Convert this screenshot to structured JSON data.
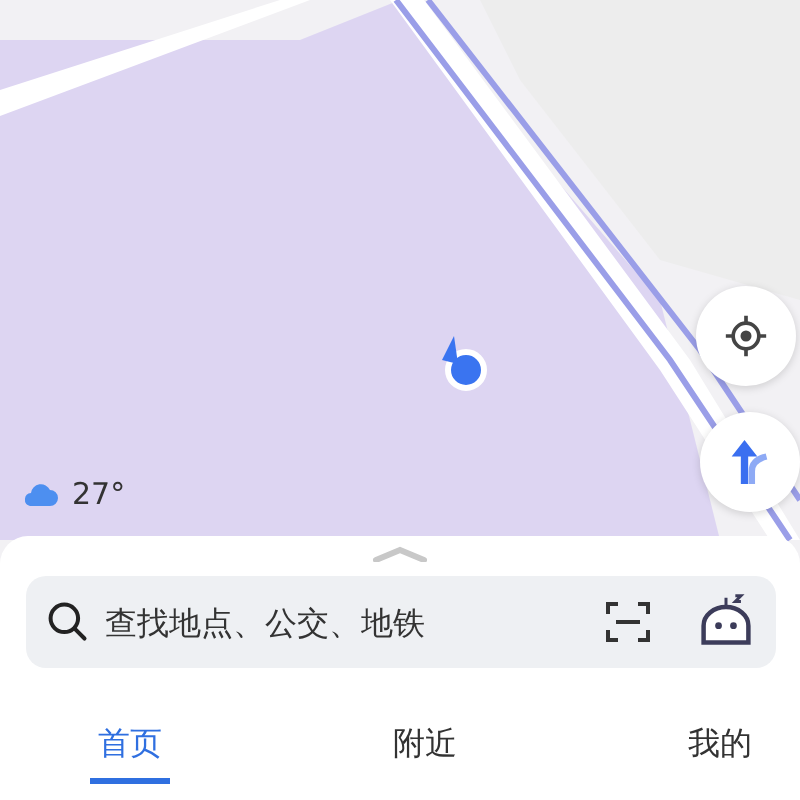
{
  "weather": {
    "temperature": "27°"
  },
  "search": {
    "placeholder": "查找地点、公交、地铁"
  },
  "tabs": [
    {
      "label": "首页",
      "selected": true
    },
    {
      "label": "附近",
      "selected": false
    },
    {
      "label": "我的",
      "selected": false
    }
  ]
}
